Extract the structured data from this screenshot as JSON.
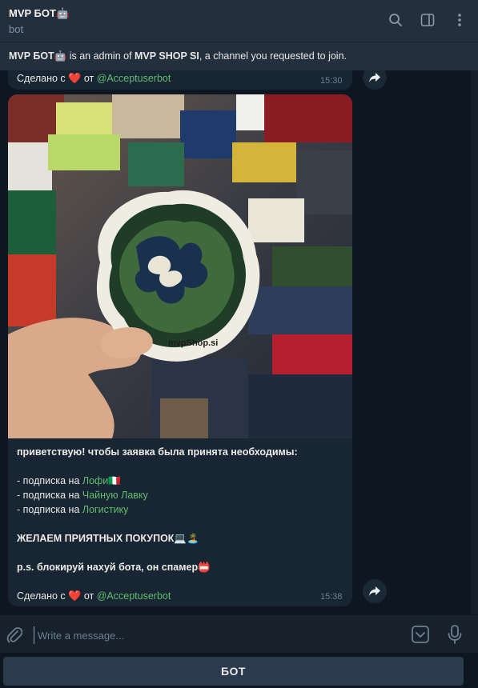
{
  "header": {
    "title": "MVP БОТ🤖",
    "subtitle": "bot",
    "icons": [
      "search-icon",
      "sidebar-toggle-icon",
      "more-vertical-icon"
    ]
  },
  "banner": {
    "bot_name": "MVP БОТ🤖",
    "middle_text": " is an admin of ",
    "channel_name": "MVP SHOP SI",
    "tail_text": ", a channel you requested to join."
  },
  "prev_message": {
    "made_with": "Сделано с",
    "heart": "❤️",
    "from_word": "от",
    "author_link": "@Acceptuserbot",
    "time": "15:30"
  },
  "message": {
    "greeting": "приветствую! чтобы заявка была принята необходимы:",
    "sub_prefix_1": " - подписка на ",
    "sub_link_1": "Лофи🇮🇹",
    "sub_prefix_2": "- подписка на ",
    "sub_link_2": "Чайную Лавку",
    "sub_prefix_3": "- подписка на ",
    "sub_link_3": "Логистику",
    "wish": "ЖЕЛАЕМ ПРИЯТНЫХ ПОКУПОК💻🏝️",
    "ps": "p.s. блокируй нахуй бота, он спамер📛",
    "made_with": "Сделано с",
    "heart": "❤️",
    "from_word": "от",
    "author_link": "@Acceptuserbot",
    "time": "15:38",
    "sticker_text": "mvpShop.si"
  },
  "composer": {
    "placeholder": "Write a message..."
  },
  "bot_button": {
    "label": "БОТ"
  },
  "colors": {
    "link": "#5fbd6f",
    "bubble": "#182533",
    "header": "#242f3d",
    "background": "#0e1621"
  }
}
